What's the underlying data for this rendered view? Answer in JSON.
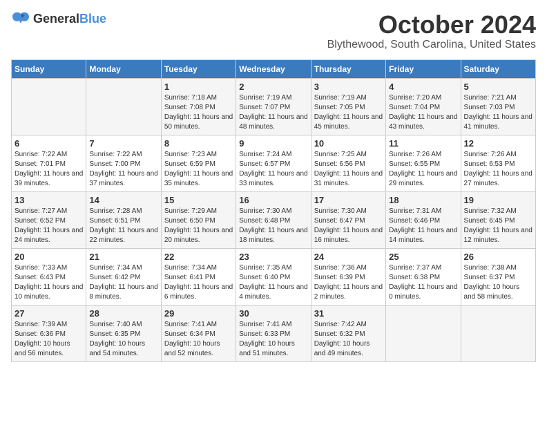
{
  "logo": {
    "general": "General",
    "blue": "Blue"
  },
  "header": {
    "month": "October 2024",
    "location": "Blythewood, South Carolina, United States"
  },
  "weekdays": [
    "Sunday",
    "Monday",
    "Tuesday",
    "Wednesday",
    "Thursday",
    "Friday",
    "Saturday"
  ],
  "weeks": [
    [
      {
        "day": "",
        "sunrise": "",
        "sunset": "",
        "daylight": ""
      },
      {
        "day": "",
        "sunrise": "",
        "sunset": "",
        "daylight": ""
      },
      {
        "day": "1",
        "sunrise": "Sunrise: 7:18 AM",
        "sunset": "Sunset: 7:08 PM",
        "daylight": "Daylight: 11 hours and 50 minutes."
      },
      {
        "day": "2",
        "sunrise": "Sunrise: 7:19 AM",
        "sunset": "Sunset: 7:07 PM",
        "daylight": "Daylight: 11 hours and 48 minutes."
      },
      {
        "day": "3",
        "sunrise": "Sunrise: 7:19 AM",
        "sunset": "Sunset: 7:05 PM",
        "daylight": "Daylight: 11 hours and 45 minutes."
      },
      {
        "day": "4",
        "sunrise": "Sunrise: 7:20 AM",
        "sunset": "Sunset: 7:04 PM",
        "daylight": "Daylight: 11 hours and 43 minutes."
      },
      {
        "day": "5",
        "sunrise": "Sunrise: 7:21 AM",
        "sunset": "Sunset: 7:03 PM",
        "daylight": "Daylight: 11 hours and 41 minutes."
      }
    ],
    [
      {
        "day": "6",
        "sunrise": "Sunrise: 7:22 AM",
        "sunset": "Sunset: 7:01 PM",
        "daylight": "Daylight: 11 hours and 39 minutes."
      },
      {
        "day": "7",
        "sunrise": "Sunrise: 7:22 AM",
        "sunset": "Sunset: 7:00 PM",
        "daylight": "Daylight: 11 hours and 37 minutes."
      },
      {
        "day": "8",
        "sunrise": "Sunrise: 7:23 AM",
        "sunset": "Sunset: 6:59 PM",
        "daylight": "Daylight: 11 hours and 35 minutes."
      },
      {
        "day": "9",
        "sunrise": "Sunrise: 7:24 AM",
        "sunset": "Sunset: 6:57 PM",
        "daylight": "Daylight: 11 hours and 33 minutes."
      },
      {
        "day": "10",
        "sunrise": "Sunrise: 7:25 AM",
        "sunset": "Sunset: 6:56 PM",
        "daylight": "Daylight: 11 hours and 31 minutes."
      },
      {
        "day": "11",
        "sunrise": "Sunrise: 7:26 AM",
        "sunset": "Sunset: 6:55 PM",
        "daylight": "Daylight: 11 hours and 29 minutes."
      },
      {
        "day": "12",
        "sunrise": "Sunrise: 7:26 AM",
        "sunset": "Sunset: 6:53 PM",
        "daylight": "Daylight: 11 hours and 27 minutes."
      }
    ],
    [
      {
        "day": "13",
        "sunrise": "Sunrise: 7:27 AM",
        "sunset": "Sunset: 6:52 PM",
        "daylight": "Daylight: 11 hours and 24 minutes."
      },
      {
        "day": "14",
        "sunrise": "Sunrise: 7:28 AM",
        "sunset": "Sunset: 6:51 PM",
        "daylight": "Daylight: 11 hours and 22 minutes."
      },
      {
        "day": "15",
        "sunrise": "Sunrise: 7:29 AM",
        "sunset": "Sunset: 6:50 PM",
        "daylight": "Daylight: 11 hours and 20 minutes."
      },
      {
        "day": "16",
        "sunrise": "Sunrise: 7:30 AM",
        "sunset": "Sunset: 6:48 PM",
        "daylight": "Daylight: 11 hours and 18 minutes."
      },
      {
        "day": "17",
        "sunrise": "Sunrise: 7:30 AM",
        "sunset": "Sunset: 6:47 PM",
        "daylight": "Daylight: 11 hours and 16 minutes."
      },
      {
        "day": "18",
        "sunrise": "Sunrise: 7:31 AM",
        "sunset": "Sunset: 6:46 PM",
        "daylight": "Daylight: 11 hours and 14 minutes."
      },
      {
        "day": "19",
        "sunrise": "Sunrise: 7:32 AM",
        "sunset": "Sunset: 6:45 PM",
        "daylight": "Daylight: 11 hours and 12 minutes."
      }
    ],
    [
      {
        "day": "20",
        "sunrise": "Sunrise: 7:33 AM",
        "sunset": "Sunset: 6:43 PM",
        "daylight": "Daylight: 11 hours and 10 minutes."
      },
      {
        "day": "21",
        "sunrise": "Sunrise: 7:34 AM",
        "sunset": "Sunset: 6:42 PM",
        "daylight": "Daylight: 11 hours and 8 minutes."
      },
      {
        "day": "22",
        "sunrise": "Sunrise: 7:34 AM",
        "sunset": "Sunset: 6:41 PM",
        "daylight": "Daylight: 11 hours and 6 minutes."
      },
      {
        "day": "23",
        "sunrise": "Sunrise: 7:35 AM",
        "sunset": "Sunset: 6:40 PM",
        "daylight": "Daylight: 11 hours and 4 minutes."
      },
      {
        "day": "24",
        "sunrise": "Sunrise: 7:36 AM",
        "sunset": "Sunset: 6:39 PM",
        "daylight": "Daylight: 11 hours and 2 minutes."
      },
      {
        "day": "25",
        "sunrise": "Sunrise: 7:37 AM",
        "sunset": "Sunset: 6:38 PM",
        "daylight": "Daylight: 11 hours and 0 minutes."
      },
      {
        "day": "26",
        "sunrise": "Sunrise: 7:38 AM",
        "sunset": "Sunset: 6:37 PM",
        "daylight": "Daylight: 10 hours and 58 minutes."
      }
    ],
    [
      {
        "day": "27",
        "sunrise": "Sunrise: 7:39 AM",
        "sunset": "Sunset: 6:36 PM",
        "daylight": "Daylight: 10 hours and 56 minutes."
      },
      {
        "day": "28",
        "sunrise": "Sunrise: 7:40 AM",
        "sunset": "Sunset: 6:35 PM",
        "daylight": "Daylight: 10 hours and 54 minutes."
      },
      {
        "day": "29",
        "sunrise": "Sunrise: 7:41 AM",
        "sunset": "Sunset: 6:34 PM",
        "daylight": "Daylight: 10 hours and 52 minutes."
      },
      {
        "day": "30",
        "sunrise": "Sunrise: 7:41 AM",
        "sunset": "Sunset: 6:33 PM",
        "daylight": "Daylight: 10 hours and 51 minutes."
      },
      {
        "day": "31",
        "sunrise": "Sunrise: 7:42 AM",
        "sunset": "Sunset: 6:32 PM",
        "daylight": "Daylight: 10 hours and 49 minutes."
      },
      {
        "day": "",
        "sunrise": "",
        "sunset": "",
        "daylight": ""
      },
      {
        "day": "",
        "sunrise": "",
        "sunset": "",
        "daylight": ""
      }
    ]
  ]
}
